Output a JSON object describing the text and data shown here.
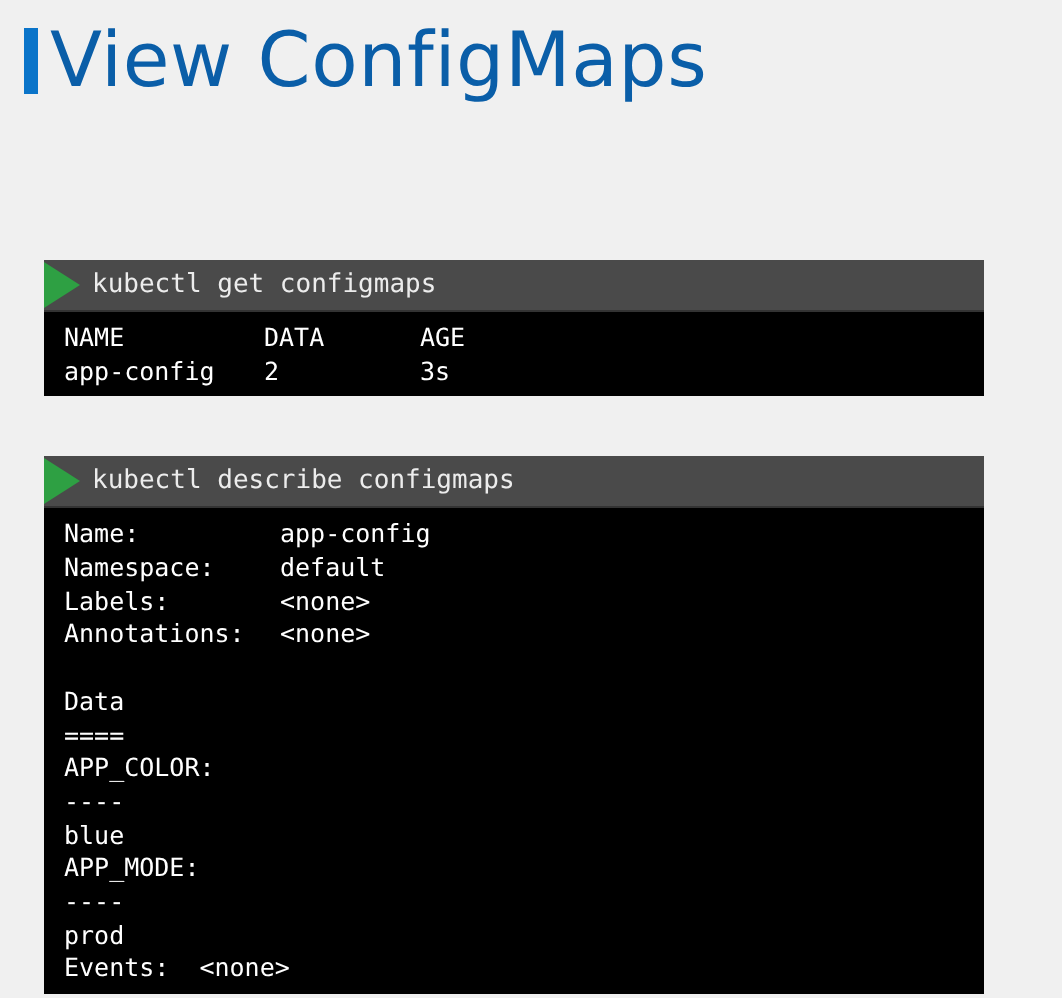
{
  "title": "View ConfigMaps",
  "terminals": [
    {
      "command": "kubectl get configmaps",
      "kind": "table",
      "columns": [
        "NAME",
        "DATA",
        "AGE"
      ],
      "rows": [
        [
          "app-config",
          "2",
          "3s"
        ]
      ]
    },
    {
      "command": "kubectl describe configmaps",
      "kind": "lines",
      "lines": [
        {
          "kind": "pair",
          "key": "Name:",
          "value": "app-config"
        },
        {
          "kind": "pair",
          "key": "Namespace:",
          "value": "default"
        },
        {
          "kind": "pair",
          "key": "Labels:",
          "value": "<none>"
        },
        {
          "kind": "pair",
          "key": "Annotations:",
          "value": "<none>"
        },
        {
          "kind": "blank"
        },
        {
          "kind": "text",
          "text": "Data"
        },
        {
          "kind": "text",
          "text": "===="
        },
        {
          "kind": "text",
          "text": "APP_COLOR:"
        },
        {
          "kind": "text",
          "text": "----"
        },
        {
          "kind": "text",
          "text": "blue"
        },
        {
          "kind": "text",
          "text": "APP_MODE:"
        },
        {
          "kind": "text",
          "text": "----"
        },
        {
          "kind": "text",
          "text": "prod"
        },
        {
          "kind": "text",
          "text": "Events:  <none>"
        }
      ]
    }
  ]
}
